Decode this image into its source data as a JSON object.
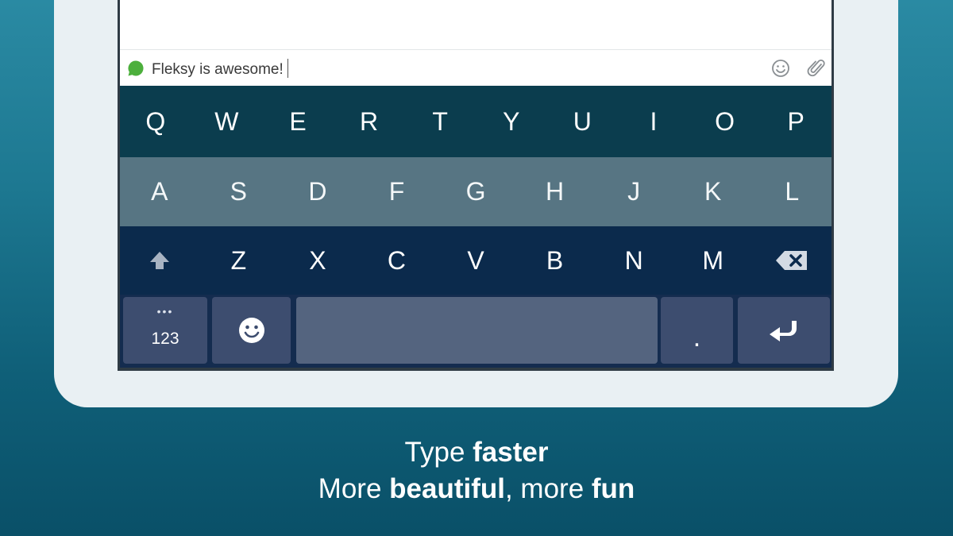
{
  "compose": {
    "text": "Fleksy is awesome!"
  },
  "keyboard": {
    "row1": [
      "Q",
      "W",
      "E",
      "R",
      "T",
      "Y",
      "U",
      "I",
      "O",
      "P"
    ],
    "row2": [
      "A",
      "S",
      "D",
      "F",
      "G",
      "H",
      "J",
      "K",
      "L"
    ],
    "row3": [
      "Z",
      "X",
      "C",
      "V",
      "B",
      "N",
      "M"
    ],
    "numbers_label": "123",
    "period_label": ".",
    "numbers_dots": "•••"
  },
  "tagline": {
    "line1_pre": "Type ",
    "line1_bold": "faster",
    "line2_pre": "More ",
    "line2_bold1": "beautiful",
    "line2_mid": ", more ",
    "line2_bold2": "fun"
  },
  "colors": {
    "bubble": "#4caf3c",
    "row1": "#0b3d4e",
    "row2": "#577583",
    "row3": "#0b2a4c",
    "row4": "#142c4f"
  },
  "icons": [
    "chat-bubble-icon",
    "emoji-icon",
    "paperclip-icon",
    "shift-icon",
    "backspace-icon",
    "smiley-icon",
    "enter-icon"
  ]
}
